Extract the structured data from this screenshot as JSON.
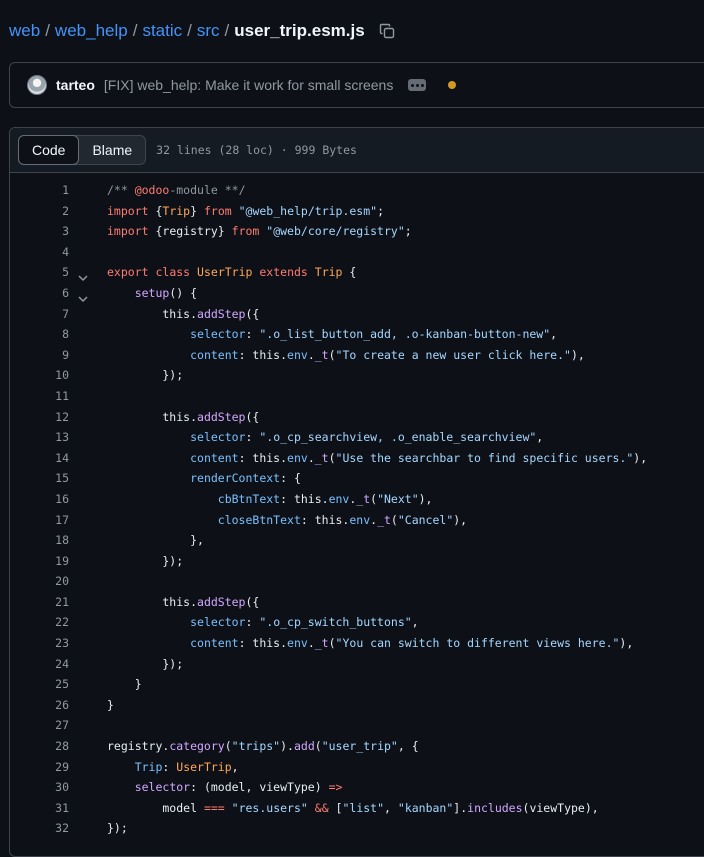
{
  "breadcrumb": {
    "items": [
      "web",
      "web_help",
      "static",
      "src"
    ],
    "separator": "/",
    "file": "user_trip.esm.js",
    "copy_icon": "copy-icon"
  },
  "commit": {
    "author": "tarteo",
    "message": "[FIX] web_help: Make it work for small screens",
    "ellipsis_icon": "ellipsis-icon",
    "status_color": "#d29922"
  },
  "viewer": {
    "tabs": [
      "Code",
      "Blame"
    ],
    "active_tab": "Code",
    "meta": "32 lines (28 loc) · 999 Bytes"
  },
  "colors": {
    "link": "#4493f8",
    "keyword": "#ff7b72",
    "function": "#d2a8ff",
    "string": "#a5d6ff",
    "property": "#79c0ff",
    "type": "#ffa657",
    "comment": "#9198a1"
  },
  "code": {
    "lines": [
      {
        "fold": false,
        "tokens": [
          {
            "t": "/** ",
            "c": "cm"
          },
          {
            "t": "@odoo",
            "c": "kw"
          },
          {
            "t": "-module **/",
            "c": "cm"
          }
        ]
      },
      {
        "fold": false,
        "tokens": [
          {
            "t": "import",
            "c": "kw"
          },
          {
            "t": " {",
            "c": "plain"
          },
          {
            "t": "Trip",
            "c": "type"
          },
          {
            "t": "} ",
            "c": "plain"
          },
          {
            "t": "from",
            "c": "kw"
          },
          {
            "t": " ",
            "c": "plain"
          },
          {
            "t": "\"@web_help/trip.esm\"",
            "c": "str"
          },
          {
            "t": ";",
            "c": "plain"
          }
        ]
      },
      {
        "fold": false,
        "tokens": [
          {
            "t": "import",
            "c": "kw"
          },
          {
            "t": " {registry} ",
            "c": "plain"
          },
          {
            "t": "from",
            "c": "kw"
          },
          {
            "t": " ",
            "c": "plain"
          },
          {
            "t": "\"@web/core/registry\"",
            "c": "str"
          },
          {
            "t": ";",
            "c": "plain"
          }
        ]
      },
      {
        "fold": false,
        "tokens": []
      },
      {
        "fold": true,
        "tokens": [
          {
            "t": "export",
            "c": "kw"
          },
          {
            "t": " ",
            "c": "plain"
          },
          {
            "t": "class",
            "c": "kw"
          },
          {
            "t": " ",
            "c": "plain"
          },
          {
            "t": "UserTrip",
            "c": "type"
          },
          {
            "t": " ",
            "c": "plain"
          },
          {
            "t": "extends",
            "c": "kw"
          },
          {
            "t": " ",
            "c": "plain"
          },
          {
            "t": "Trip",
            "c": "type"
          },
          {
            "t": " {",
            "c": "plain"
          }
        ]
      },
      {
        "fold": true,
        "tokens": [
          {
            "t": "    ",
            "c": "plain"
          },
          {
            "t": "setup",
            "c": "fn"
          },
          {
            "t": "() {",
            "c": "plain"
          }
        ]
      },
      {
        "fold": false,
        "tokens": [
          {
            "t": "        this.",
            "c": "plain"
          },
          {
            "t": "addStep",
            "c": "fn"
          },
          {
            "t": "({",
            "c": "plain"
          }
        ]
      },
      {
        "fold": false,
        "tokens": [
          {
            "t": "            ",
            "c": "plain"
          },
          {
            "t": "selector",
            "c": "prop"
          },
          {
            "t": ": ",
            "c": "plain"
          },
          {
            "t": "\".o_list_button_add, .o-kanban-button-new\"",
            "c": "str"
          },
          {
            "t": ",",
            "c": "plain"
          }
        ]
      },
      {
        "fold": false,
        "tokens": [
          {
            "t": "            ",
            "c": "plain"
          },
          {
            "t": "content",
            "c": "prop"
          },
          {
            "t": ": this.",
            "c": "plain"
          },
          {
            "t": "env",
            "c": "prop"
          },
          {
            "t": ".",
            "c": "plain"
          },
          {
            "t": "_t",
            "c": "fn"
          },
          {
            "t": "(",
            "c": "plain"
          },
          {
            "t": "\"To create a new user click here.\"",
            "c": "str"
          },
          {
            "t": "),",
            "c": "plain"
          }
        ]
      },
      {
        "fold": false,
        "tokens": [
          {
            "t": "        });",
            "c": "plain"
          }
        ]
      },
      {
        "fold": false,
        "tokens": []
      },
      {
        "fold": false,
        "tokens": [
          {
            "t": "        this.",
            "c": "plain"
          },
          {
            "t": "addStep",
            "c": "fn"
          },
          {
            "t": "({",
            "c": "plain"
          }
        ]
      },
      {
        "fold": false,
        "tokens": [
          {
            "t": "            ",
            "c": "plain"
          },
          {
            "t": "selector",
            "c": "prop"
          },
          {
            "t": ": ",
            "c": "plain"
          },
          {
            "t": "\".o_cp_searchview, .o_enable_searchview\"",
            "c": "str"
          },
          {
            "t": ",",
            "c": "plain"
          }
        ]
      },
      {
        "fold": false,
        "tokens": [
          {
            "t": "            ",
            "c": "plain"
          },
          {
            "t": "content",
            "c": "prop"
          },
          {
            "t": ": this.",
            "c": "plain"
          },
          {
            "t": "env",
            "c": "prop"
          },
          {
            "t": ".",
            "c": "plain"
          },
          {
            "t": "_t",
            "c": "fn"
          },
          {
            "t": "(",
            "c": "plain"
          },
          {
            "t": "\"Use the searchbar to find specific users.\"",
            "c": "str"
          },
          {
            "t": "),",
            "c": "plain"
          }
        ]
      },
      {
        "fold": false,
        "tokens": [
          {
            "t": "            ",
            "c": "plain"
          },
          {
            "t": "renderContext",
            "c": "prop"
          },
          {
            "t": ": {",
            "c": "plain"
          }
        ]
      },
      {
        "fold": false,
        "tokens": [
          {
            "t": "                ",
            "c": "plain"
          },
          {
            "t": "cbBtnText",
            "c": "prop"
          },
          {
            "t": ": this.",
            "c": "plain"
          },
          {
            "t": "env",
            "c": "prop"
          },
          {
            "t": ".",
            "c": "plain"
          },
          {
            "t": "_t",
            "c": "fn"
          },
          {
            "t": "(",
            "c": "plain"
          },
          {
            "t": "\"Next\"",
            "c": "str"
          },
          {
            "t": "),",
            "c": "plain"
          }
        ]
      },
      {
        "fold": false,
        "tokens": [
          {
            "t": "                ",
            "c": "plain"
          },
          {
            "t": "closeBtnText",
            "c": "prop"
          },
          {
            "t": ": this.",
            "c": "plain"
          },
          {
            "t": "env",
            "c": "prop"
          },
          {
            "t": ".",
            "c": "plain"
          },
          {
            "t": "_t",
            "c": "fn"
          },
          {
            "t": "(",
            "c": "plain"
          },
          {
            "t": "\"Cancel\"",
            "c": "str"
          },
          {
            "t": "),",
            "c": "plain"
          }
        ]
      },
      {
        "fold": false,
        "tokens": [
          {
            "t": "            },",
            "c": "plain"
          }
        ]
      },
      {
        "fold": false,
        "tokens": [
          {
            "t": "        });",
            "c": "plain"
          }
        ]
      },
      {
        "fold": false,
        "tokens": []
      },
      {
        "fold": false,
        "tokens": [
          {
            "t": "        this.",
            "c": "plain"
          },
          {
            "t": "addStep",
            "c": "fn"
          },
          {
            "t": "({",
            "c": "plain"
          }
        ]
      },
      {
        "fold": false,
        "tokens": [
          {
            "t": "            ",
            "c": "plain"
          },
          {
            "t": "selector",
            "c": "prop"
          },
          {
            "t": ": ",
            "c": "plain"
          },
          {
            "t": "\".o_cp_switch_buttons\"",
            "c": "str"
          },
          {
            "t": ",",
            "c": "plain"
          }
        ]
      },
      {
        "fold": false,
        "tokens": [
          {
            "t": "            ",
            "c": "plain"
          },
          {
            "t": "content",
            "c": "prop"
          },
          {
            "t": ": this.",
            "c": "plain"
          },
          {
            "t": "env",
            "c": "prop"
          },
          {
            "t": ".",
            "c": "plain"
          },
          {
            "t": "_t",
            "c": "fn"
          },
          {
            "t": "(",
            "c": "plain"
          },
          {
            "t": "\"You can switch to different views here.\"",
            "c": "str"
          },
          {
            "t": "),",
            "c": "plain"
          }
        ]
      },
      {
        "fold": false,
        "tokens": [
          {
            "t": "        });",
            "c": "plain"
          }
        ]
      },
      {
        "fold": false,
        "tokens": [
          {
            "t": "    }",
            "c": "plain"
          }
        ]
      },
      {
        "fold": false,
        "tokens": [
          {
            "t": "}",
            "c": "plain"
          }
        ]
      },
      {
        "fold": false,
        "tokens": []
      },
      {
        "fold": false,
        "tokens": [
          {
            "t": "registry.",
            "c": "plain"
          },
          {
            "t": "category",
            "c": "fn"
          },
          {
            "t": "(",
            "c": "plain"
          },
          {
            "t": "\"trips\"",
            "c": "str"
          },
          {
            "t": ").",
            "c": "plain"
          },
          {
            "t": "add",
            "c": "fn"
          },
          {
            "t": "(",
            "c": "plain"
          },
          {
            "t": "\"user_trip\"",
            "c": "str"
          },
          {
            "t": ", {",
            "c": "plain"
          }
        ]
      },
      {
        "fold": false,
        "tokens": [
          {
            "t": "    ",
            "c": "plain"
          },
          {
            "t": "Trip",
            "c": "prop"
          },
          {
            "t": ": ",
            "c": "plain"
          },
          {
            "t": "UserTrip",
            "c": "type"
          },
          {
            "t": ",",
            "c": "plain"
          }
        ]
      },
      {
        "fold": false,
        "tokens": [
          {
            "t": "    ",
            "c": "plain"
          },
          {
            "t": "selector",
            "c": "fn"
          },
          {
            "t": ": (model, viewType) ",
            "c": "plain"
          },
          {
            "t": "=>",
            "c": "kw"
          }
        ]
      },
      {
        "fold": false,
        "tokens": [
          {
            "t": "        model ",
            "c": "plain"
          },
          {
            "t": "===",
            "c": "kw"
          },
          {
            "t": " ",
            "c": "plain"
          },
          {
            "t": "\"res.users\"",
            "c": "str"
          },
          {
            "t": " ",
            "c": "plain"
          },
          {
            "t": "&&",
            "c": "kw"
          },
          {
            "t": " [",
            "c": "plain"
          },
          {
            "t": "\"list\"",
            "c": "str"
          },
          {
            "t": ", ",
            "c": "plain"
          },
          {
            "t": "\"kanban\"",
            "c": "str"
          },
          {
            "t": "].",
            "c": "plain"
          },
          {
            "t": "includes",
            "c": "fn"
          },
          {
            "t": "(viewType),",
            "c": "plain"
          }
        ]
      },
      {
        "fold": false,
        "tokens": [
          {
            "t": "});",
            "c": "plain"
          }
        ]
      }
    ]
  }
}
